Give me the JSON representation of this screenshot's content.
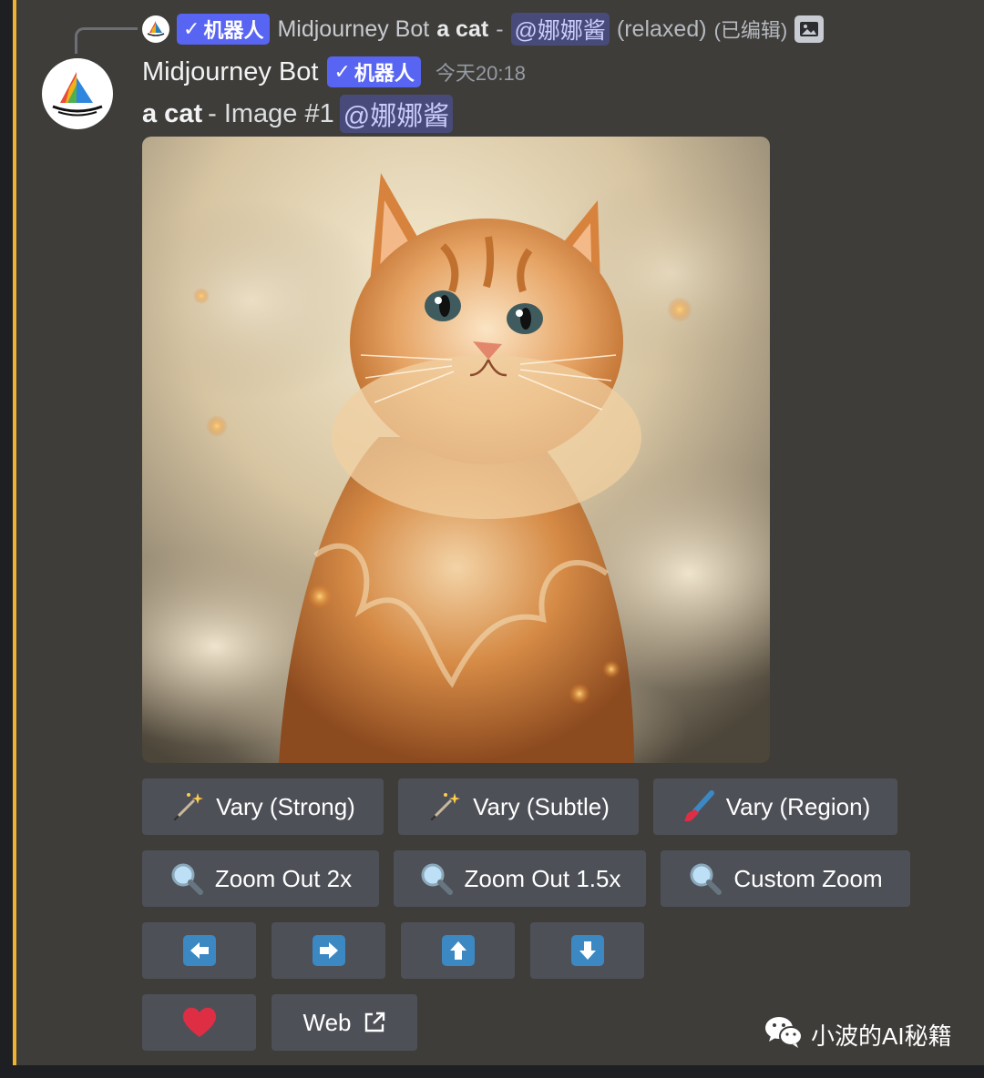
{
  "reply": {
    "bot_name": "Midjourney Bot",
    "badge": "机器人",
    "prompt": "a cat",
    "separator": "-",
    "mention": "@娜娜酱",
    "mode": "(relaxed)",
    "edited": "(已编辑)"
  },
  "message": {
    "author": "Midjourney Bot",
    "badge": "机器人",
    "timestamp": "今天20:18",
    "prompt": "a cat",
    "caption": "- Image #1",
    "mention": "@娜娜酱"
  },
  "buttons": {
    "vary_strong": "Vary (Strong)",
    "vary_subtle": "Vary (Subtle)",
    "vary_region": "Vary (Region)",
    "zoom_out_2x": "Zoom Out 2x",
    "zoom_out_1_5x": "Zoom Out 1.5x",
    "custom_zoom": "Custom Zoom",
    "web": "Web"
  },
  "watermark": "小波的AI秘籍",
  "colors": {
    "accent": "#f0b232",
    "badge": "#5865f2",
    "button": "#4e5058",
    "arrow": "#3b88c3",
    "heart": "#dd2e44"
  }
}
